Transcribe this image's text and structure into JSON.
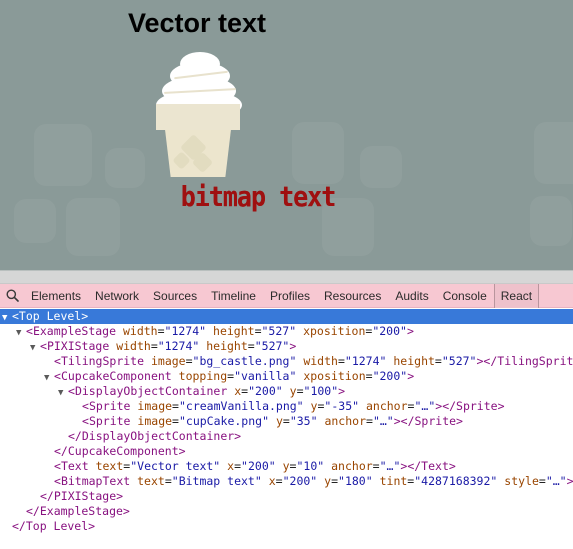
{
  "stage": {
    "background_color": "#8a9a98",
    "tile_color": "#909f9d",
    "vector_text": "Vector text",
    "vector_text_color": "#000000",
    "bitmap_text": "bitmap text",
    "bitmap_text_color": "#9f1010",
    "cupcake_cream_color": "#ffffff",
    "cupcake_cup_color": "#ece5cd"
  },
  "toolbar": {
    "search_icon": "search-icon",
    "tabs": [
      {
        "label": "Elements",
        "selected": false
      },
      {
        "label": "Network",
        "selected": false
      },
      {
        "label": "Sources",
        "selected": false
      },
      {
        "label": "Timeline",
        "selected": false
      },
      {
        "label": "Profiles",
        "selected": false
      },
      {
        "label": "Resources",
        "selected": false
      },
      {
        "label": "Audits",
        "selected": false
      },
      {
        "label": "Console",
        "selected": false
      },
      {
        "label": "React",
        "selected": true
      }
    ],
    "background_color": "#f7c8d2",
    "selected_tab_color": "#eec1cb"
  },
  "dom_tree": {
    "selected_row_color": "#3879d9",
    "rows": [
      {
        "indent": 0,
        "arrow": "▼",
        "selected": true,
        "open": "<Top Level>",
        "attrs": []
      },
      {
        "indent": 1,
        "arrow": "▼",
        "selected": false,
        "tag": "ExampleStage",
        "attrs": [
          {
            "name": "width",
            "value": "1274"
          },
          {
            "name": "height",
            "value": "527"
          },
          {
            "name": "xposition",
            "value": "200"
          }
        ],
        "close_inline": ""
      },
      {
        "indent": 2,
        "arrow": "▼",
        "selected": false,
        "tag": "PIXIStage",
        "attrs": [
          {
            "name": "width",
            "value": "1274"
          },
          {
            "name": "height",
            "value": "527"
          }
        ],
        "close_inline": ""
      },
      {
        "indent": 3,
        "arrow": "",
        "selected": false,
        "tag": "TilingSprite",
        "attrs": [
          {
            "name": "image",
            "value": "bg_castle.png"
          },
          {
            "name": "width",
            "value": "1274"
          },
          {
            "name": "height",
            "value": "527"
          }
        ],
        "close_inline": "</TilingSprit"
      },
      {
        "indent": 3,
        "arrow": "▼",
        "selected": false,
        "tag": "CupcakeComponent",
        "attrs": [
          {
            "name": "topping",
            "value": "vanilla"
          },
          {
            "name": "xposition",
            "value": "200"
          }
        ],
        "close_inline": ""
      },
      {
        "indent": 4,
        "arrow": "▼",
        "selected": false,
        "tag": "DisplayObjectContainer",
        "attrs": [
          {
            "name": "x",
            "value": "200"
          },
          {
            "name": "y",
            "value": "100"
          }
        ],
        "close_inline": ""
      },
      {
        "indent": 5,
        "arrow": "",
        "selected": false,
        "tag": "Sprite",
        "attrs": [
          {
            "name": "image",
            "value": "creamVanilla.png"
          },
          {
            "name": "y",
            "value": "-35"
          },
          {
            "name": "anchor",
            "value": "…"
          }
        ],
        "close_inline": "</Sprite>"
      },
      {
        "indent": 5,
        "arrow": "",
        "selected": false,
        "tag": "Sprite",
        "attrs": [
          {
            "name": "image",
            "value": "cupCake.png"
          },
          {
            "name": "y",
            "value": "35"
          },
          {
            "name": "anchor",
            "value": "…"
          }
        ],
        "close_inline": "</Sprite>"
      },
      {
        "indent": 4,
        "arrow": "",
        "selected": false,
        "closing": "</DisplayObjectContainer>"
      },
      {
        "indent": 3,
        "arrow": "",
        "selected": false,
        "closing": "</CupcakeComponent>"
      },
      {
        "indent": 3,
        "arrow": "",
        "selected": false,
        "tag": "Text",
        "attrs": [
          {
            "name": "text",
            "value": "Vector text"
          },
          {
            "name": "x",
            "value": "200"
          },
          {
            "name": "y",
            "value": "10"
          },
          {
            "name": "anchor",
            "value": "…"
          }
        ],
        "close_inline": "</Text>"
      },
      {
        "indent": 3,
        "arrow": "",
        "selected": false,
        "tag": "BitmapText",
        "attrs": [
          {
            "name": "text",
            "value": "Bitmap text"
          },
          {
            "name": "x",
            "value": "200"
          },
          {
            "name": "y",
            "value": "180"
          },
          {
            "name": "tint",
            "value": "4287168392"
          },
          {
            "name": "style",
            "value": "…"
          }
        ],
        "close_inline": ""
      },
      {
        "indent": 2,
        "arrow": "",
        "selected": false,
        "closing": "</PIXIStage>"
      },
      {
        "indent": 1,
        "arrow": "",
        "selected": false,
        "closing": "</ExampleStage>"
      },
      {
        "indent": 0,
        "arrow": "",
        "selected": false,
        "closing": "</Top Level>"
      }
    ]
  }
}
